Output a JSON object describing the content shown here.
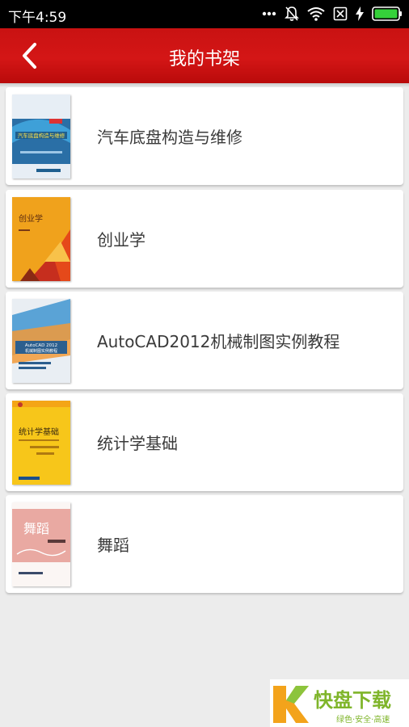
{
  "status_bar": {
    "time": "下午4:59",
    "icons": [
      "more-dots-icon",
      "notification-off-icon",
      "wifi-icon",
      "sim-off-icon",
      "charging-icon",
      "battery-icon"
    ]
  },
  "app_bar": {
    "title": "我的书架",
    "back_icon": "chevron-left-icon"
  },
  "colors": {
    "app_bar": "#d41616",
    "background": "#ececec",
    "card": "#ffffff",
    "title_text": "#3a3a3a"
  },
  "books": [
    {
      "title": "汽车底盘构造与维修",
      "cover_text": "汽车底盘构造与维修"
    },
    {
      "title": "创业学",
      "cover_text": "创业学"
    },
    {
      "title": "AutoCAD2012机械制图实例教程",
      "cover_text": "AutoCAD 2012 机械制图实例教程"
    },
    {
      "title": "统计学基础",
      "cover_text": "统计学基础"
    },
    {
      "title": "舞蹈",
      "cover_text": "舞蹈"
    }
  ],
  "watermark": {
    "brand": "快盘下载",
    "slogan": "绿色·安全·高速"
  }
}
